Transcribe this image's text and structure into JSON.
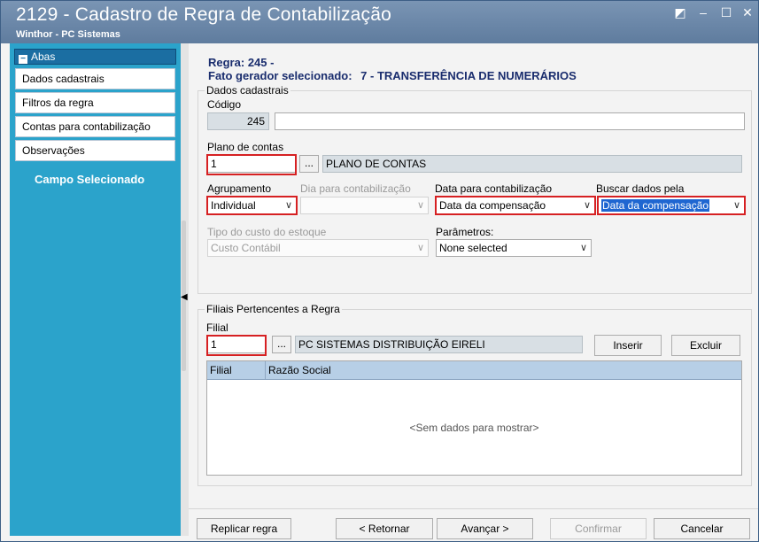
{
  "window": {
    "title": "2129 - Cadastro de Regra de Contabilização",
    "subtitle": "Winthor - PC Sistemas",
    "controls": {
      "restore": "◩",
      "minimize": "–",
      "maximize": "☐",
      "close": "✕"
    }
  },
  "sidebar": {
    "header": "Abas",
    "items": [
      {
        "label": "Dados cadastrais"
      },
      {
        "label": "Filtros da regra"
      },
      {
        "label": "Contas para contabilização"
      },
      {
        "label": "Observações"
      }
    ],
    "selected_field_label": "Campo Selecionado"
  },
  "rule": {
    "rule_label": "Regra:",
    "rule_value": "245 -",
    "trigger_label": "Fato gerador selecionado:",
    "trigger_value": "7 - TRANSFERÊNCIA DE NUMERÁRIOS"
  },
  "dados": {
    "group_title": "Dados cadastrais",
    "codigo_label": "Código",
    "codigo_value": "245",
    "descricao_value": "",
    "plano_label": "Plano de contas",
    "plano_value": "1",
    "plano_desc": "PLANO DE CONTAS",
    "agrupamento_label": "Agrupamento",
    "agrupamento_value": "Individual",
    "dia_label": "Dia para contabilização",
    "dia_value": "",
    "data_label": "Data para contabilização",
    "data_value": "Data da compensação",
    "buscar_label": "Buscar dados pela",
    "buscar_value": "Data da compensação",
    "tipo_custo_label": "Tipo do custo do estoque",
    "tipo_custo_value": "Custo Contábil",
    "parametros_label": "Parâmetros:",
    "parametros_value": "None selected"
  },
  "filiais": {
    "group_title": "Filiais Pertencentes a Regra",
    "filial_label": "Filial",
    "filial_value": "1",
    "filial_desc": "PC SISTEMAS DISTRIBUIÇÃO EIRELI",
    "inserir_label": "Inserir",
    "excluir_label": "Excluir",
    "columns": [
      "Filial",
      "Razão Social"
    ],
    "empty_text": "<Sem dados para mostrar>"
  },
  "footer": {
    "replicar": "Replicar regra",
    "retornar": "< Retornar",
    "avancar": "Avançar >",
    "confirmar": "Confirmar",
    "cancelar": "Cancelar"
  },
  "glyphs": {
    "dots": "...",
    "chevron": "∨",
    "collapse_arrow": "◀"
  },
  "colors": {
    "titlebar": "#6c88a9",
    "sidebar": "#2ba3cb",
    "header_text": "#1a2d6e",
    "highlight": "#d62022",
    "grid_header": "#b7cfe6"
  }
}
